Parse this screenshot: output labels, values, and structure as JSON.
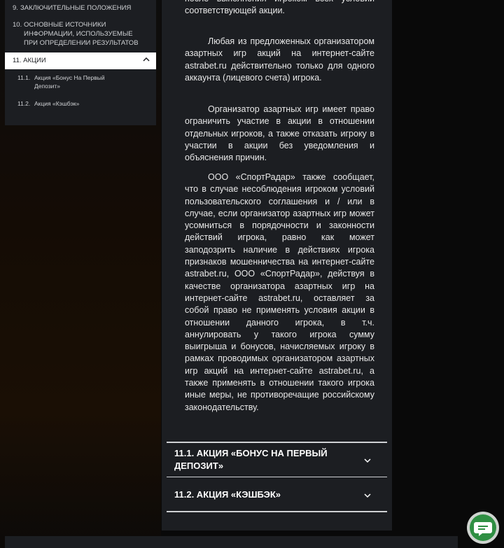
{
  "sidebar": {
    "items": [
      {
        "num": "9.",
        "label": "ЗАКЛЮЧИТЕЛЬНЫЕ ПОЛОЖЕНИЯ"
      },
      {
        "num": "10.",
        "label": "ОСНОВНЫЕ ИСТОЧНИКИ ИНФОРМАЦИИ, ИСПОЛЬЗУЕМЫЕ ПРИ ОПРЕДЕЛЕНИИ РЕЗУЛЬТАТОВ"
      }
    ],
    "active": {
      "label": "11. АКЦИИ"
    },
    "subitems": [
      {
        "num": "11.1.",
        "label": "Акция «Бонус На Первый Депозит»"
      },
      {
        "num": "11.2.",
        "label": "Акция «Кэшбэк»"
      }
    ]
  },
  "main": {
    "top_fragment": "после выполнения игроком всех условий соответствующей акции.",
    "paragraphs": [
      "Любая из предложенных организатором азартных игр акций на интернет-сайте astrabet.ru действительно только для одного аккаунта (лицевого счета) игрока.",
      "Организатор азартных игр имеет право ограничить участие в акции в отношении отдельных игроков, а также отказать игроку в участии в акции без уведомления и объяснения причин.",
      "ООО «СпортРадар» также сообщает, что в случае несоблюдения игроком условий пользовательского соглашения и / или в случае, если организатор азартных игр может усомниться в порядочности и законности действий игрока, равно как может заподозрить наличие в действиях игрока признаков мошенничества на интернет-сайте astrabet.ru, ООО «СпортРадар», действуя в качестве организатора азартных игр на интернет-сайте astrabet.ru, оставляет за собой право не применять условия акции в отношении данного игрока, в т.ч. аннулировать у такого игрока сумму выигрыша и бонусов, начисляемых игроку в рамках проводимых организатором азартных игр акций на интернет-сайте astrabet.ru, а также применять в отношении такого игрока иные меры, не противоречащие российскому законодательству."
    ],
    "accordion": [
      {
        "title": "11.1. Акция «Бонус на первый депозит»"
      },
      {
        "title": "11.2. Акция «Кэшбэк»"
      }
    ]
  },
  "icons": {
    "chevron_up": "chevron-up-icon",
    "chevron_down": "chevron-down-icon",
    "chat": "chat-icon"
  },
  "colors": {
    "panel": "#1c1e22",
    "page": "#090909",
    "chat_green": "#2f8f43"
  }
}
